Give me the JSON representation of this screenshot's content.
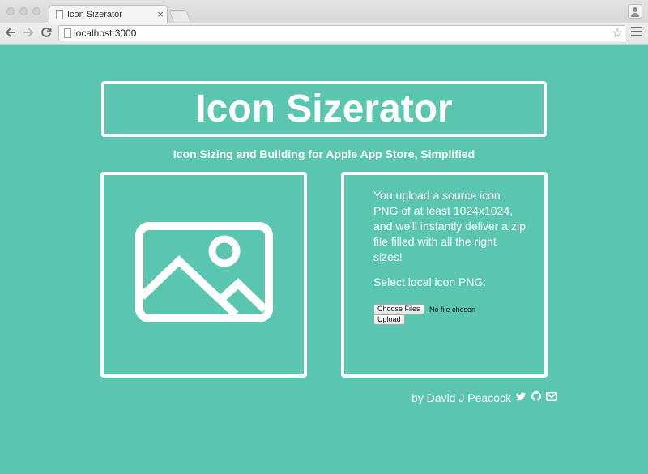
{
  "browser": {
    "tab_title": "Icon Sizerator",
    "tab_close": "×",
    "url": "localhost:3000",
    "icons": [
      "back-icon",
      "forward-icon",
      "reload-icon",
      "star-icon",
      "menu-icon",
      "profile-icon"
    ]
  },
  "header": {
    "title": "Icon Sizerator",
    "subtitle": "Icon Sizing and Building for Apple App Store, Simplified"
  },
  "upload_panel": {
    "description": "You upload a source icon PNG of at least 1024x1024, and we'll instantly deliver a zip file filled with all the right sizes!",
    "select_label": "Select local icon PNG:",
    "choose_files_label": "Choose Files",
    "no_file_text": "No file chosen",
    "upload_label": "Upload"
  },
  "footer": {
    "byline": "by David J Peacock",
    "icons": [
      "twitter-icon",
      "github-icon",
      "email-icon"
    ]
  },
  "colors": {
    "background": "#5ac6b0",
    "foreground": "#ffffff"
  }
}
